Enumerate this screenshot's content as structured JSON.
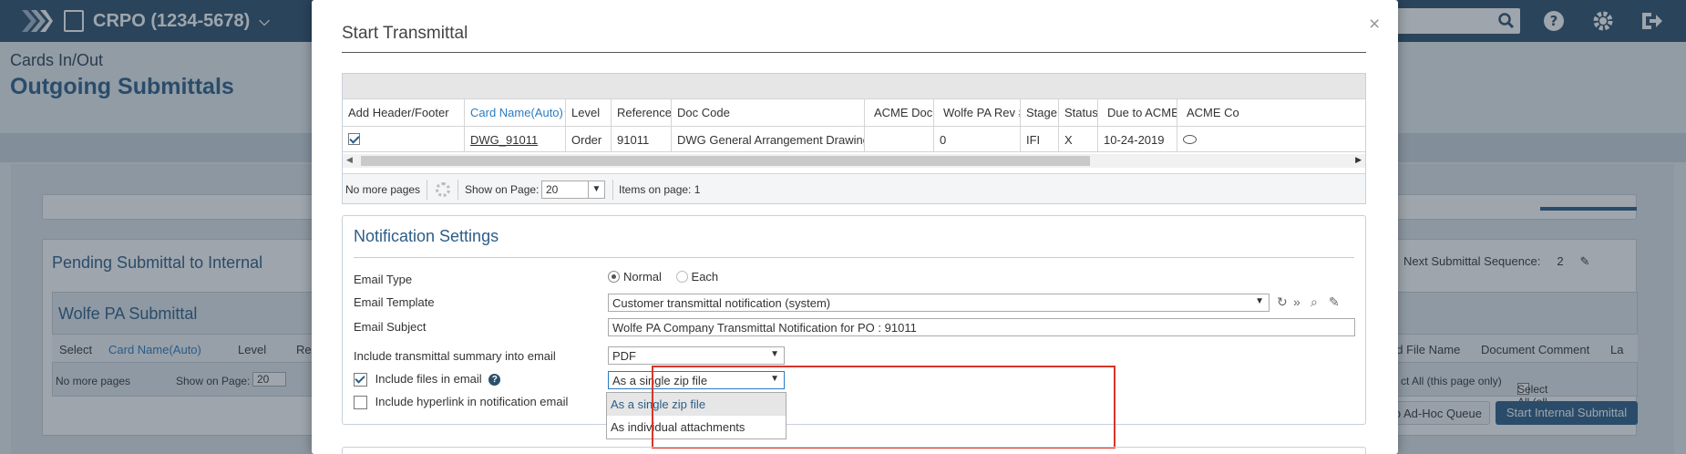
{
  "app": {
    "project": "CRPO (1234-5678)",
    "breadcrumb": "Cards In/Out",
    "page_title": "Outgoing Submittals"
  },
  "background": {
    "pending_title": "Pending Submittal to Internal",
    "next_seq_label": "Next Submittal Sequence:",
    "next_seq_value": "2",
    "wolfe_title": "Wolfe PA Submittal",
    "columns": [
      "Select",
      "Card Name(Auto)",
      "Level",
      "Re",
      "ed File Name",
      "Document Comment",
      "La"
    ],
    "pager_no_more": "No more pages",
    "pager_show_on_page": "Show on Page:",
    "pager_size": "20",
    "select_all_page": "ct All (this page only)",
    "select_all_all": "Select All (all pages)",
    "adhoc_button": "o Ad-Hoc Queue",
    "start_internal_button": "Start Internal Submittal"
  },
  "modal": {
    "title": "Start Transmittal",
    "close": "×",
    "grid": {
      "headers": [
        "Add Header/Footer",
        "Card Name(Auto)",
        "Level",
        "Reference",
        "Doc Code",
        "ACME Doc #",
        "Wolfe PA Rev #",
        "Stage",
        "Status",
        "Due to ACME",
        "ACME Co"
      ],
      "row": {
        "card_name": "DWG_91011",
        "level": "Order",
        "reference": "91011",
        "doc_code": "DWG General Arrangement Drawings",
        "acme_doc": "",
        "rev": "0",
        "stage": "IFI",
        "status": "X",
        "due": "10-24-2019"
      },
      "pager": {
        "no_more": "No more pages",
        "show_on_page": "Show on Page:",
        "page_size": "20",
        "items_on_page": "Items on page: 1"
      }
    },
    "notification": {
      "title": "Notification Settings",
      "email_type_label": "Email Type",
      "email_type_normal": "Normal",
      "email_type_each": "Each",
      "template_label": "Email Template",
      "template_value": "Customer transmittal notification (system)",
      "subject_label": "Email Subject",
      "subject_value": "Wolfe PA Company Transmittal Notification for PO : 91011",
      "summary_label": "Include transmittal summary into email",
      "summary_value": "PDF",
      "include_files_label": "Include files in email",
      "include_files_value": "As a single zip file",
      "include_hyperlink_label": "Include hyperlink in notification email",
      "dropdown_options": [
        "As a single zip file",
        "As individual attachments"
      ]
    }
  }
}
